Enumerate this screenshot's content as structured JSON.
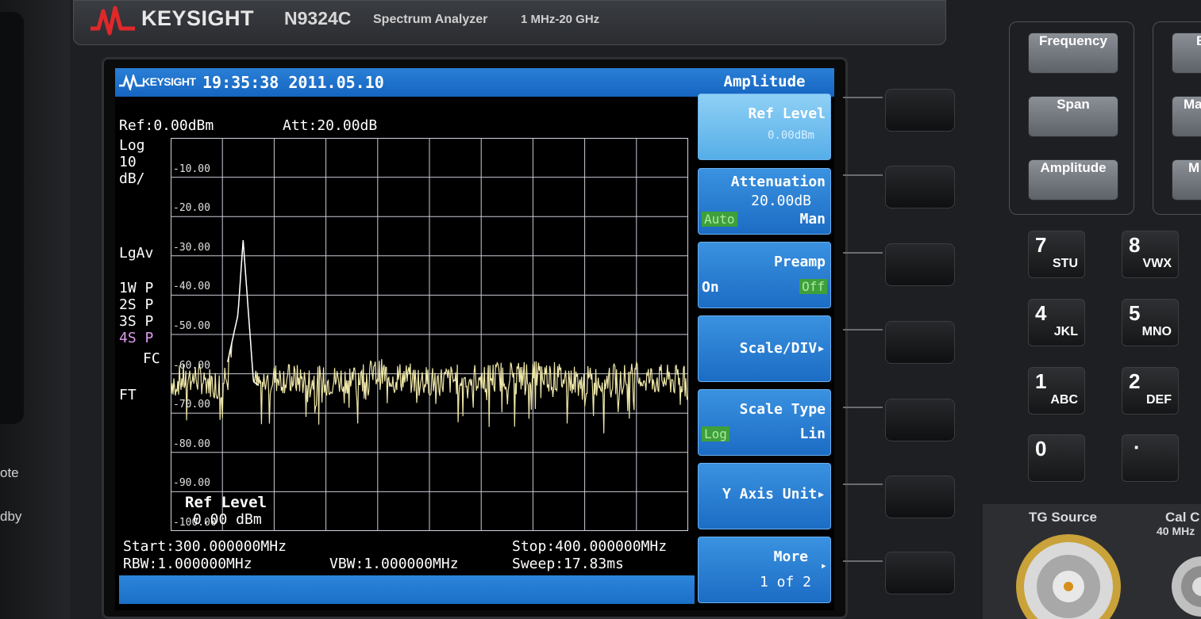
{
  "device": {
    "brand": "KEYSIGHT",
    "model": "N9324C",
    "description": "Spectrum Analyzer",
    "freq_range": "1 MHz-20 GHz",
    "left_labels": [
      "ote",
      "dby"
    ]
  },
  "screen": {
    "mini_brand": "KEYSIGHT",
    "datetime": "19:35:38 2011.05.10",
    "menu_title": "Amplitude",
    "ref": "Ref:0.00dBm",
    "att": "Att:20.00dB",
    "scale_lines": [
      "Log",
      "10",
      "dB/"
    ],
    "avg_type": "LgAv",
    "traces": [
      "1W P",
      "2S P",
      "3S P",
      "4S P"
    ],
    "fc": "FC",
    "ft": "FT",
    "ref_level_label": "Ref Level",
    "ref_level_value": "0.00 dBm",
    "start": "Start:300.000000MHz",
    "stop": "Stop:400.000000MHz",
    "rbw": "RBW:1.000000MHz",
    "vbw": "VBW:1.000000MHz",
    "sweep": "Sweep:17.83ms"
  },
  "softkeys": [
    {
      "title": "Ref Level",
      "sub": "0.00dBm"
    },
    {
      "title": "Attenuation",
      "sub": "20.00dB",
      "opt_left": "Auto",
      "opt_right": "Man"
    },
    {
      "title": "Preamp",
      "opt_left": "On",
      "opt_right": "Off"
    },
    {
      "title": "Scale/DIV▸"
    },
    {
      "title": "Scale Type",
      "opt_left": "Log",
      "opt_right": "Lin"
    },
    {
      "title": "Y Axis Unit▸"
    },
    {
      "title": "More",
      "sub": "1 of 2"
    }
  ],
  "chart_data": {
    "type": "line",
    "title": "",
    "xlabel": "",
    "ylabel": "",
    "xlim": [
      300,
      400
    ],
    "ylim": [
      -100,
      0
    ],
    "y_tick_labels": [
      "-10.00",
      "-20.00",
      "-30.00",
      "-40.00",
      "-50.00",
      "-60.00",
      "-70.00",
      "-80.00",
      "-90.00",
      "-100.00"
    ],
    "grid": true,
    "series": [
      {
        "color": "#e8e0a0",
        "x": [
          300,
          305,
          310,
          313,
          314,
          315,
          316,
          317,
          320,
          330,
          340,
          350,
          360,
          370,
          380,
          390,
          400
        ],
        "y": [
          -62,
          -61,
          -63,
          -45,
          -26,
          -44,
          -62,
          -63,
          -61,
          -62,
          -60,
          -62,
          -61,
          -60,
          -62,
          -61,
          -62
        ]
      }
    ]
  },
  "hardware_keys": {
    "function": [
      "Frequency",
      "Span",
      "Amplitude"
    ],
    "right_partial": [
      "B",
      "Ma",
      "M"
    ],
    "numpad": [
      {
        "digit": "7",
        "letters": "STU"
      },
      {
        "digit": "8",
        "letters": "VWX"
      },
      {
        "digit": "4",
        "letters": "JKL"
      },
      {
        "digit": "5",
        "letters": "MNO"
      },
      {
        "digit": "1",
        "letters": "ABC"
      },
      {
        "digit": "2",
        "letters": "DEF"
      },
      {
        "digit": "0",
        "letters": ""
      },
      {
        "digit": "·",
        "letters": ""
      }
    ],
    "tg_source": "TG Source",
    "cal_label": "Cal C",
    "cal_freq": "40 MHz"
  }
}
